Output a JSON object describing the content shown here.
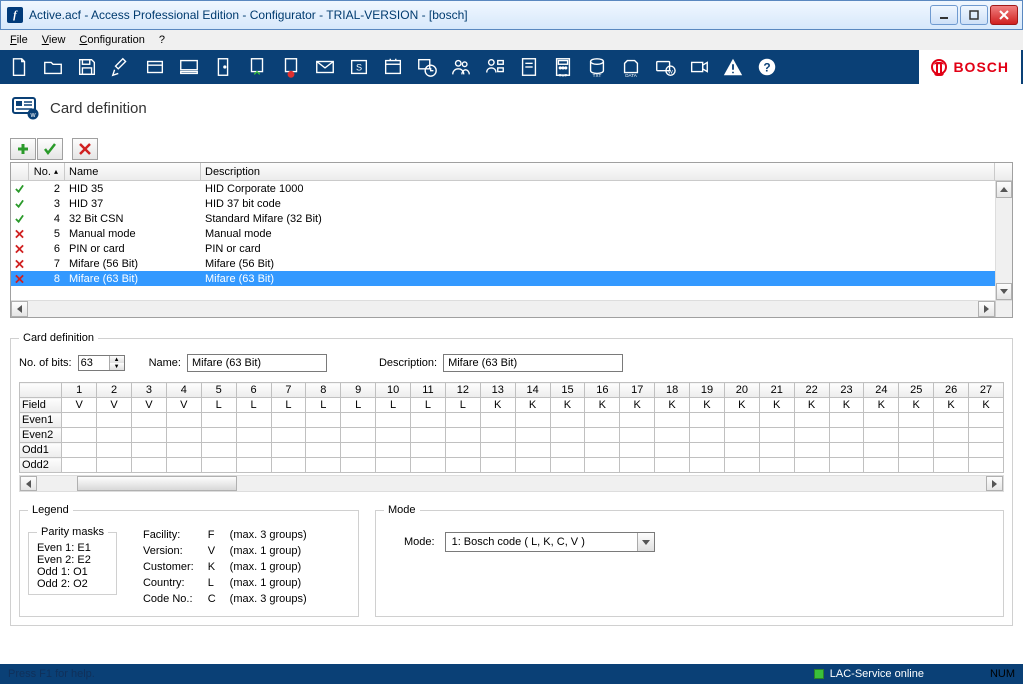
{
  "window": {
    "title": "Active.acf - Access Professional Edition - Configurator - TRIAL-VERSION - [bosch]"
  },
  "menu": {
    "file": "File",
    "view": "View",
    "config": "Configuration",
    "help": "?"
  },
  "brand": "BOSCH",
  "page": {
    "title": "Card definition"
  },
  "grid": {
    "headers": {
      "no": "No.",
      "name": "Name",
      "desc": "Description"
    },
    "rows": [
      {
        "ok": true,
        "no": "2",
        "name": "HID 35",
        "desc": "HID Corporate 1000"
      },
      {
        "ok": true,
        "no": "3",
        "name": "HID 37",
        "desc": "HID 37 bit code"
      },
      {
        "ok": true,
        "no": "4",
        "name": "32 Bit CSN",
        "desc": "Standard Mifare (32 Bit)"
      },
      {
        "ok": false,
        "no": "5",
        "name": "Manual mode",
        "desc": "Manual mode"
      },
      {
        "ok": false,
        "no": "6",
        "name": "PIN or card",
        "desc": "PIN or card"
      },
      {
        "ok": false,
        "no": "7",
        "name": "Mifare (56 Bit)",
        "desc": "Mifare (56 Bit)"
      },
      {
        "ok": false,
        "no": "8",
        "name": "Mifare (63 Bit)",
        "desc": "Mifare (63 Bit)",
        "selected": true
      }
    ]
  },
  "def": {
    "legend": "Card definition",
    "bits_label": "No. of bits:",
    "bits_value": "63",
    "name_label": "Name:",
    "name_value": "Mifare (63 Bit)",
    "desc_label": "Description:",
    "desc_value": "Mifare (63 Bit)",
    "rowheads": [
      "Field",
      "Even1",
      "Even2",
      "Odd1",
      "Odd2"
    ],
    "cols": [
      "1",
      "2",
      "3",
      "4",
      "5",
      "6",
      "7",
      "8",
      "9",
      "10",
      "11",
      "12",
      "13",
      "14",
      "15",
      "16",
      "17",
      "18",
      "19",
      "20",
      "21",
      "22",
      "23",
      "24",
      "25",
      "26",
      "27"
    ],
    "field": [
      "V",
      "V",
      "V",
      "V",
      "L",
      "L",
      "L",
      "L",
      "L",
      "L",
      "L",
      "L",
      "K",
      "K",
      "K",
      "K",
      "K",
      "K",
      "K",
      "K",
      "K",
      "K",
      "K",
      "K",
      "K",
      "K",
      "K"
    ]
  },
  "legendbox": {
    "title": "Legend",
    "pmask_title": "Parity masks",
    "pmask": [
      "Even 1: E1",
      "Even 2: E2",
      "Odd 1:  O1",
      "Odd 2:  O2"
    ],
    "tab": [
      [
        "Facility:",
        "F",
        "(max. 3 groups)"
      ],
      [
        "Version:",
        "V",
        "(max. 1 group)"
      ],
      [
        "Customer:",
        "K",
        "(max. 1 group)"
      ],
      [
        "Country:",
        "L",
        "(max. 1 group)"
      ],
      [
        "Code No.:",
        "C",
        "(max. 3 groups)"
      ]
    ]
  },
  "modebox": {
    "title": "Mode",
    "label": "Mode:",
    "value": "1: Bosch code         ( L, K, C, V )"
  },
  "status": {
    "left": "Press F1 for help.",
    "service": "LAC-Service online",
    "num": "NUM"
  }
}
